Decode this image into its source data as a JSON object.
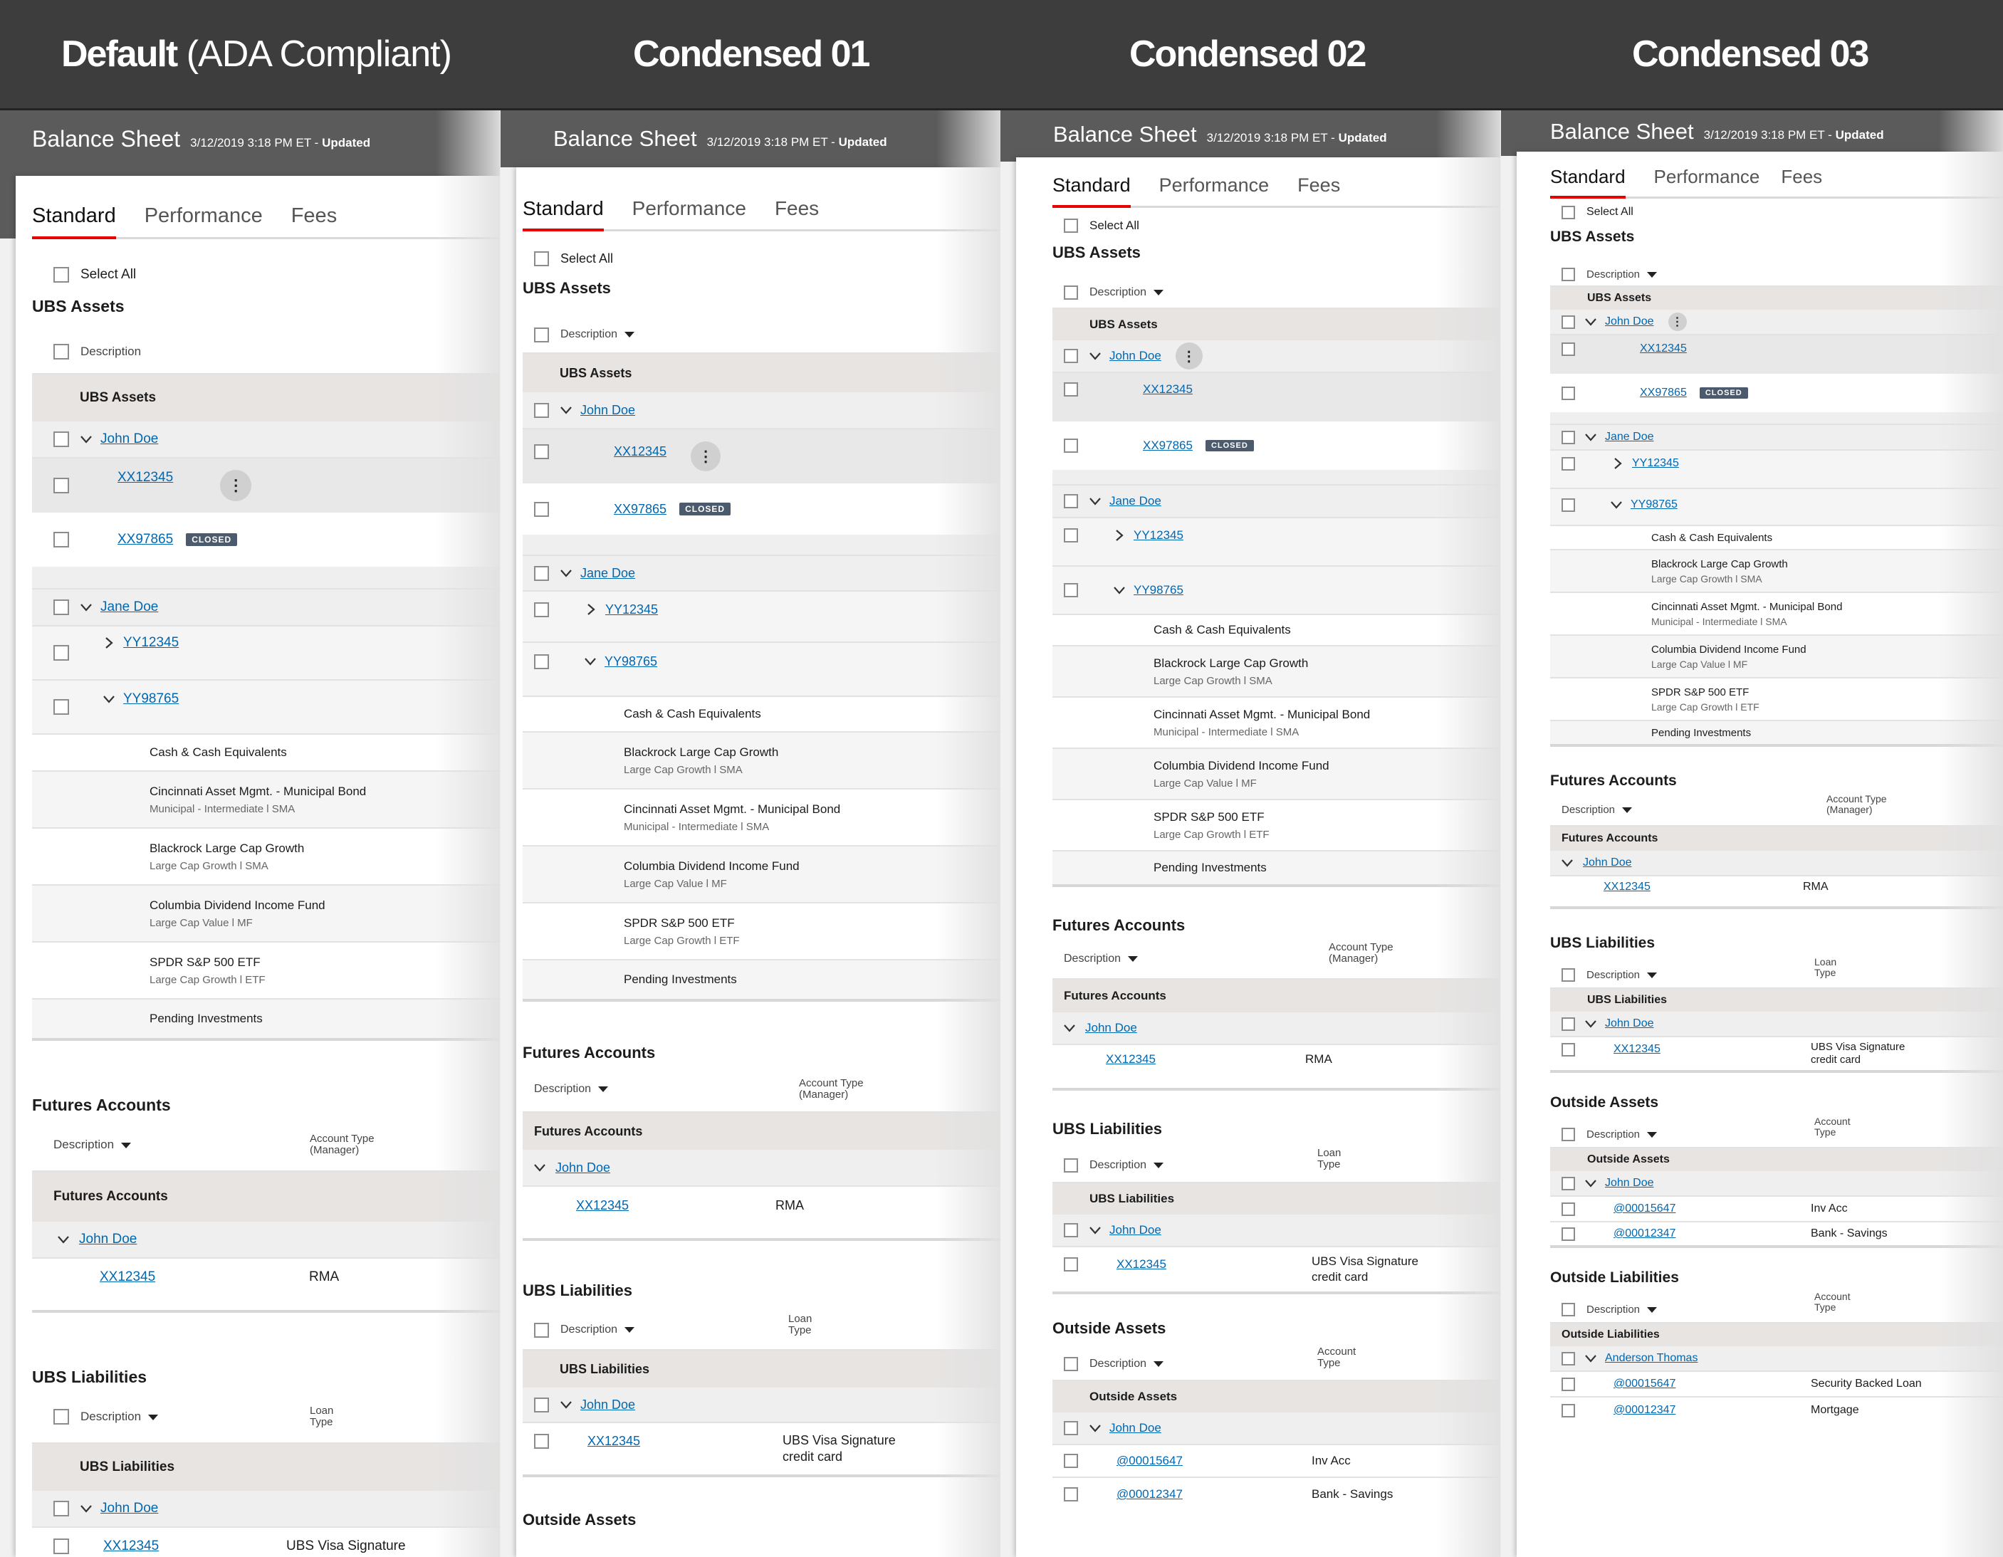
{
  "columns": [
    {
      "title_bold": "Default",
      "title_rest": " (ADA Compliant)"
    },
    {
      "title_bold": "Condensed 01",
      "title_rest": ""
    },
    {
      "title_bold": "Condensed 02",
      "title_rest": ""
    },
    {
      "title_bold": "Condensed 03",
      "title_rest": ""
    }
  ],
  "panel": {
    "title": "Balance Sheet",
    "timestamp": "3/12/2019 3:18 PM ET - ",
    "updated": "Updated",
    "tabs": [
      "Standard",
      "Performance",
      "Fees"
    ],
    "select_all": "Select All",
    "description": "Description",
    "closed_badge": "CLOSED"
  },
  "ubs_assets": {
    "title": "UBS Assets",
    "group": "UBS Assets",
    "john": "John Doe",
    "jane": "Jane Doe",
    "acct1": "XX12345",
    "acct2": "XX97865",
    "acct3": "YY12345",
    "acct4": "YY98765",
    "holdings": [
      {
        "name": "Cash & Cash Equivalents",
        "sub": ""
      },
      {
        "name": "Cincinnati Asset Mgmt. - Municipal Bond",
        "sub": "Municipal - Intermediate l SMA"
      },
      {
        "name": "Blackrock Large Cap Growth",
        "sub": "Large Cap Growth l SMA"
      },
      {
        "name": "Columbia Dividend Income Fund",
        "sub": "Large Cap Value l MF"
      },
      {
        "name": "SPDR S&P 500 ETF",
        "sub": "Large Cap Growth l ETF"
      },
      {
        "name": "Pending Investments",
        "sub": ""
      }
    ]
  },
  "futures": {
    "title": "Futures Accounts",
    "col_head_1": "Account Type",
    "col_head_2": "(Manager)",
    "group": "Futures Accounts",
    "john": "John Doe",
    "acct": "XX12345",
    "type": "RMA"
  },
  "liabilities": {
    "title": "UBS Liabilities",
    "col_head_1": "Loan",
    "col_head_2": "Type",
    "group": "UBS Liabilities",
    "john": "John Doe",
    "acct": "XX12345",
    "type_1": "UBS Visa Signature",
    "type_2": "credit card"
  },
  "outside_assets": {
    "title": "Outside Assets",
    "col_head_1": "Account",
    "col_head_2": "Type",
    "group": "Outside Assets",
    "john": "John Doe",
    "acct1": "@00015647",
    "type1": "Inv Acc",
    "acct2": "@00012347",
    "type2": "Bank - Savings"
  },
  "outside_liabilities": {
    "title": "Outside Liabilities",
    "col_head_1": "Account",
    "col_head_2": "Type",
    "group": "Outside Liabilities",
    "owner": "Anderson Thomas",
    "acct1": "@00015647",
    "type1": "Security Backed Loan",
    "acct2": "@00012347",
    "type2": "Mortgage"
  },
  "colors": {
    "accent": "#e60000",
    "link": "#0067b2",
    "header": "#3d3d3d",
    "panel_header": "#5b5b5b",
    "badge": "#4c5a6d"
  }
}
